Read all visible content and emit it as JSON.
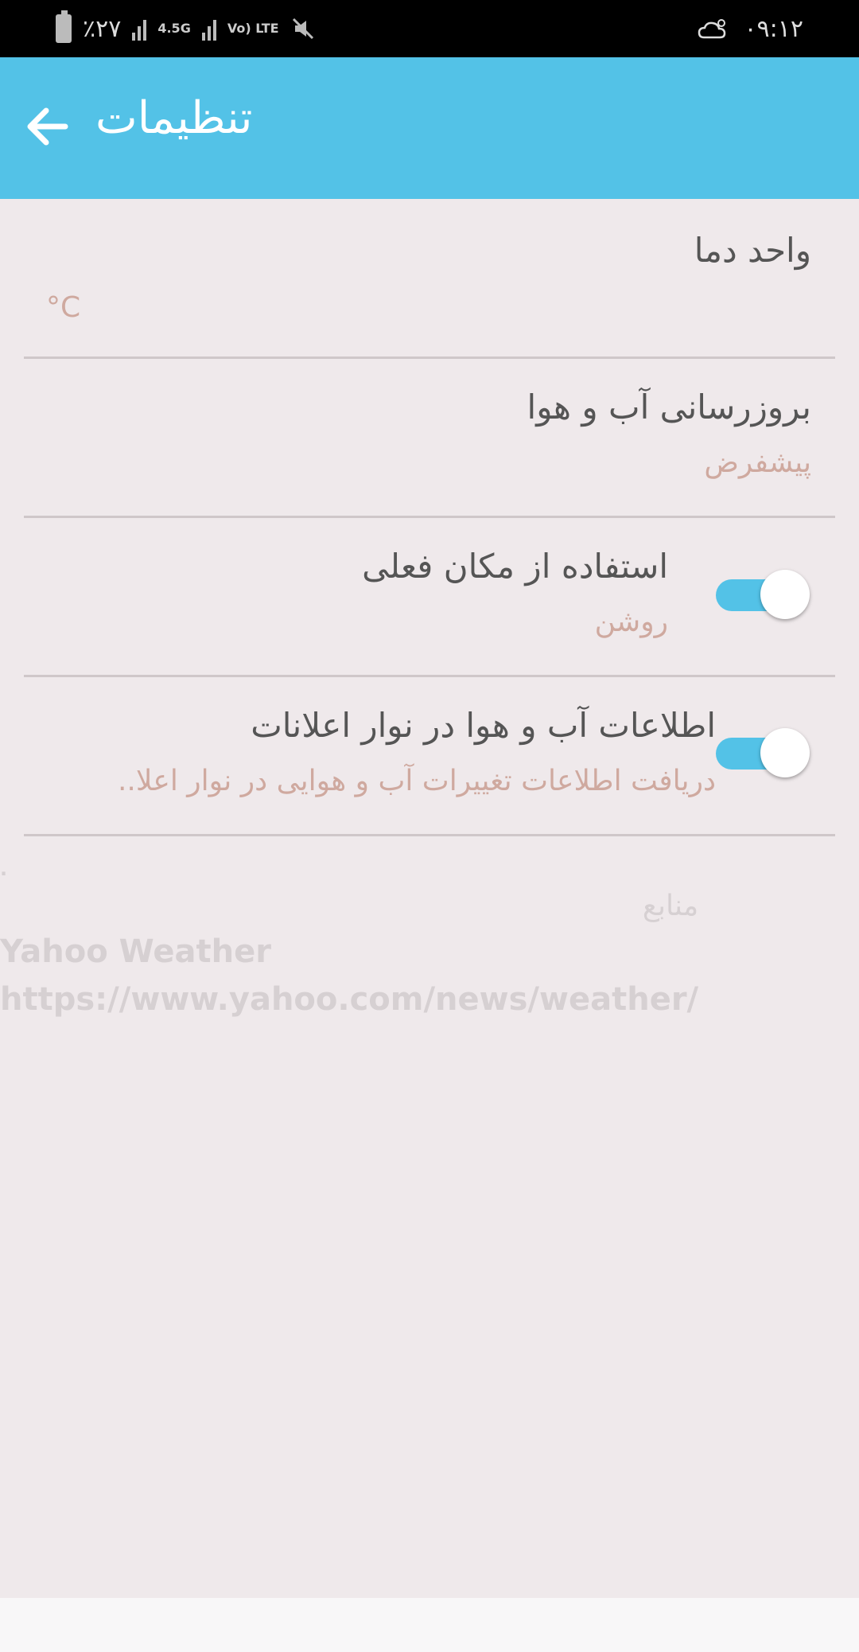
{
  "status_bar": {
    "battery": "٪۲۷",
    "network_1": "4.5G",
    "network_2": "Vo) LTE",
    "time": "۰۹:۱۲",
    "icons": [
      "battery-icon",
      "signal-icon",
      "mute-icon",
      "cloud-sun-icon"
    ]
  },
  "app_bar": {
    "title": "تنظیمات",
    "back_icon": "arrow-back-icon",
    "color": "#53c2e7"
  },
  "settings": [
    {
      "title": "واحد دما",
      "subtitle": "°C"
    },
    {
      "title": "بروزرسانی آب و هوا",
      "subtitle": "پیشفرض"
    },
    {
      "title": "استفاده از مکان فعلی",
      "subtitle": "روشن",
      "toggle": true
    },
    {
      "title": "اطلاعات آب و هوا در نوار اعلانات",
      "subtitle": "دریافت اطلاعات تغییرات آب و هوایی در نوار اعلا..",
      "toggle": true
    }
  ],
  "sources": {
    "dot": ".",
    "title": "منابع",
    "name": "Yahoo Weather",
    "url": "https://www.yahoo.com/news/weather/"
  },
  "colors": {
    "accent": "#53c2e7",
    "background": "#efe9eb",
    "subtitle": "#cfa99f"
  }
}
